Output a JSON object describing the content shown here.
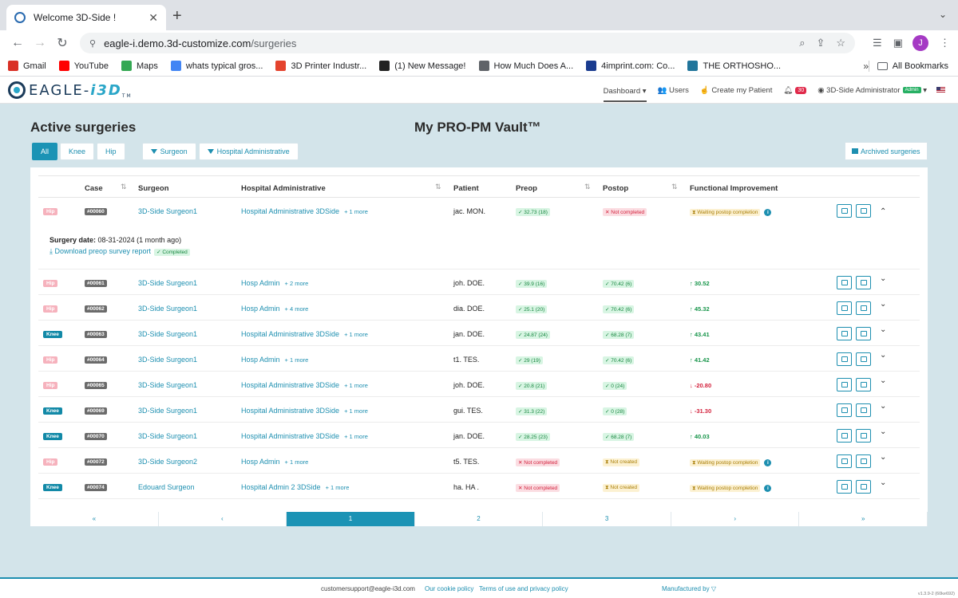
{
  "browser": {
    "tab_title": "Welcome 3D-Side !",
    "url_host": "eagle-i.demo.3d-customize.com",
    "url_path": "/surgeries",
    "profile_initial": "J",
    "bookmarks": [
      {
        "label": "Gmail",
        "icon": "gmail-icon",
        "color": "#d93025"
      },
      {
        "label": "YouTube",
        "icon": "youtube-icon",
        "color": "#ff0000"
      },
      {
        "label": "Maps",
        "icon": "maps-icon",
        "color": "#34a853"
      },
      {
        "label": "whats typical gros...",
        "icon": "google-icon",
        "color": "#4285f4"
      },
      {
        "label": "3D Printer Industr...",
        "icon": "printer-brand-icon",
        "color": "#e4432d"
      },
      {
        "label": "(1) New Message!",
        "icon": "message-icon",
        "color": "#222222"
      },
      {
        "label": "How Much Does A...",
        "icon": "globe-icon",
        "color": "#5f6368"
      },
      {
        "label": "4imprint.com: Co...",
        "icon": "4imprint-icon",
        "color": "#1a3c8f"
      },
      {
        "label": "THE ORTHOSHO...",
        "icon": "wordpress-icon",
        "color": "#21759b"
      }
    ],
    "bookmarks_more": "»",
    "all_bookmarks": "All Bookmarks"
  },
  "header": {
    "logo_text_1": "EAGLE-",
    "logo_text_2": "i3D",
    "logo_tm": "TM",
    "nav": {
      "dashboard": "Dashboard",
      "users": "Users",
      "create_patient": "Create my Patient",
      "notifications": "30",
      "account": "3D-Side Administrator",
      "admin_badge": "Admin"
    }
  },
  "page": {
    "title": "Active surgeries",
    "vault_title": "My PRO-PM Vault™",
    "filters": [
      "All",
      "Knee",
      "Hip"
    ],
    "filter_surgeon": "Surgeon",
    "filter_hospital": "Hospital Administrative",
    "archived": "Archived surgeries"
  },
  "table": {
    "headers": {
      "case": "Case",
      "surgeon": "Surgeon",
      "hospital": "Hospital Administrative",
      "patient": "Patient",
      "preop": "Preop",
      "postop": "Postop",
      "improvement": "Functional Improvement"
    },
    "expanded": {
      "surgery_date_label": "Surgery date:",
      "surgery_date_value": "08-31-2024 (1 month ago)",
      "download": "Download preop survey report",
      "completed": "Completed"
    },
    "rows": [
      {
        "type": "Hip",
        "case": "#00060",
        "surgeon": "3D-Side Surgeon1",
        "hospital": "Hospital Administrative 3DSide",
        "more": "+ 1 more",
        "patient": "jac. MON.",
        "preop": "32.73 (18)",
        "preop_status": "ok",
        "postop": "Not completed",
        "postop_status": "bad",
        "improvement": "Waiting postop completion",
        "imp_status": "warn"
      },
      {
        "type": "Hip",
        "case": "#00061",
        "surgeon": "3D-Side Surgeon1",
        "hospital": "Hosp Admin",
        "more": "+ 2 more",
        "patient": "joh. DOE.",
        "preop": "39.9 (16)",
        "preop_status": "ok",
        "postop": "70.42 (6)",
        "postop_status": "ok",
        "improvement": "30.52",
        "imp_status": "up"
      },
      {
        "type": "Hip",
        "case": "#00062",
        "surgeon": "3D-Side Surgeon1",
        "hospital": "Hosp Admin",
        "more": "+ 4 more",
        "patient": "dia. DOE.",
        "preop": "25.1 (20)",
        "preop_status": "ok",
        "postop": "70.42 (6)",
        "postop_status": "ok",
        "improvement": "45.32",
        "imp_status": "up"
      },
      {
        "type": "Knee",
        "case": "#00063",
        "surgeon": "3D-Side Surgeon1",
        "hospital": "Hospital Administrative 3DSide",
        "more": "+ 1 more",
        "patient": "jan. DOE.",
        "preop": "24.87 (24)",
        "preop_status": "ok",
        "postop": "68.28 (7)",
        "postop_status": "ok",
        "improvement": "43.41",
        "imp_status": "up"
      },
      {
        "type": "Hip",
        "case": "#00064",
        "surgeon": "3D-Side Surgeon1",
        "hospital": "Hosp Admin",
        "more": "+ 1 more",
        "patient": "t1. TES.",
        "preop": "29 (19)",
        "preop_status": "ok",
        "postop": "70.42 (6)",
        "postop_status": "ok",
        "improvement": "41.42",
        "imp_status": "up"
      },
      {
        "type": "Hip",
        "case": "#00065",
        "surgeon": "3D-Side Surgeon1",
        "hospital": "Hospital Administrative 3DSide",
        "more": "+ 1 more",
        "patient": "joh. DOE.",
        "preop": "20.8 (21)",
        "preop_status": "ok",
        "postop": "0 (24)",
        "postop_status": "ok",
        "improvement": "-20.80",
        "imp_status": "down"
      },
      {
        "type": "Knee",
        "case": "#00069",
        "surgeon": "3D-Side Surgeon1",
        "hospital": "Hospital Administrative 3DSide",
        "more": "+ 1 more",
        "patient": "gui. TES.",
        "preop": "31.3 (22)",
        "preop_status": "ok",
        "postop": "0 (28)",
        "postop_status": "ok",
        "improvement": "-31.30",
        "imp_status": "down"
      },
      {
        "type": "Knee",
        "case": "#00070",
        "surgeon": "3D-Side Surgeon1",
        "hospital": "Hospital Administrative 3DSide",
        "more": "+ 1 more",
        "patient": "jan. DOE.",
        "preop": "28.25 (23)",
        "preop_status": "ok",
        "postop": "68.28 (7)",
        "postop_status": "ok",
        "improvement": "40.03",
        "imp_status": "up"
      },
      {
        "type": "Hip",
        "case": "#00072",
        "surgeon": "3D-Side Surgeon2",
        "hospital": "Hosp Admin",
        "more": "+ 1 more",
        "patient": "t5. TES.",
        "preop": "Not completed",
        "preop_status": "bad",
        "postop": "Not created",
        "postop_status": "warn",
        "improvement": "Waiting postop completion",
        "imp_status": "warn"
      },
      {
        "type": "Knee",
        "case": "#00074",
        "surgeon": "Edouard Surgeon",
        "hospital": "Hospital Admin 2 3DSide",
        "more": "+ 1 more",
        "patient": "ha. HA .",
        "preop": "Not completed",
        "preop_status": "bad",
        "postop": "Not created",
        "postop_status": "warn",
        "improvement": "Waiting postop completion",
        "imp_status": "warn"
      }
    ]
  },
  "pagination": [
    "«",
    "‹",
    "1",
    "2",
    "3",
    "›",
    "»"
  ],
  "pagination_current": "1",
  "footer": {
    "email": "customersupport@eagle-i3d.com",
    "cookie": "Our cookie policy",
    "terms": "Terms of use and privacy policy",
    "manufactured": "Manufactured by",
    "version": "v1.3.9-2 (60ke692)"
  }
}
